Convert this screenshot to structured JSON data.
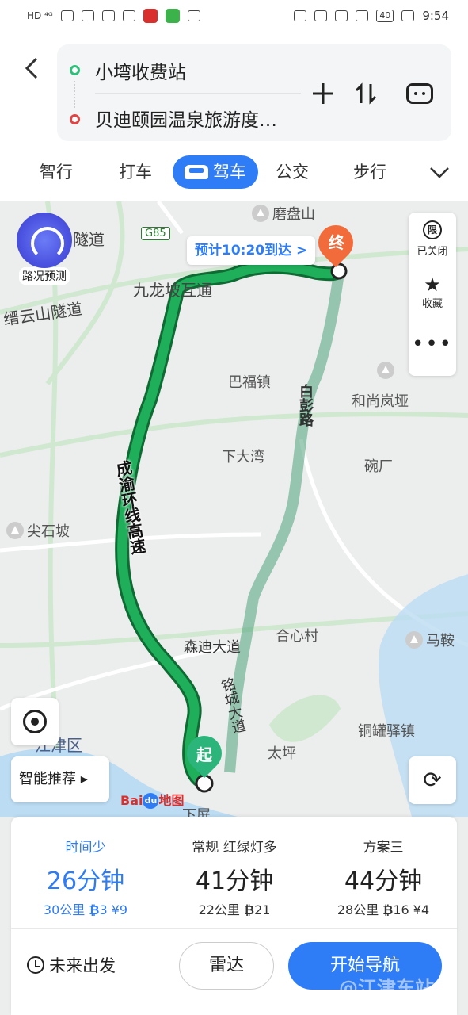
{
  "status_bar": {
    "left_text": "HD ⁴ᴳ",
    "battery": "40",
    "time": "9:54"
  },
  "header": {
    "from": "小塆收费站",
    "to": "贝迪颐园温泉旅游度…",
    "modes": [
      "智行",
      "打车",
      "驾车",
      "公交",
      "步行"
    ],
    "active_mode": "驾车"
  },
  "map": {
    "speed_widget_label": "路况预测",
    "eta_tip": "预计10:20到达 >",
    "end_pin": "终",
    "start_pin": "起",
    "side_panel": {
      "restrict_icon": "限",
      "restrict_label": "已关闭",
      "favorite_label": "收藏",
      "more": "•••"
    },
    "smart_label": "智能推荐 ▸",
    "baidu_logo": "Bai",
    "baidu_du": "du",
    "baidu_map": "地图",
    "labels": {
      "suidao": "隧道",
      "g85": "G85",
      "mopan": "磨盘山",
      "jiulongpo": "九龙坡互通",
      "jinyunshan": "缙云山隧道",
      "bafu": "巴福镇",
      "heshang": "和尚岚垭",
      "baipeng": "白彭路",
      "xiadawan": "下大湾",
      "wanchang": "碗厂",
      "jianshipo": "尖石坡",
      "chengyu": "成渝环线高速",
      "hexin": "合心村",
      "maan": "马鞍",
      "sendi": "森迪大道",
      "mingcheng": "铭城大道",
      "tongguan": "铜罐驿镇",
      "taiping": "太坪",
      "jiangjin": "江津区",
      "xiapin": "下屏"
    }
  },
  "plans": [
    {
      "tag": "时间少",
      "time": "26分钟",
      "dist": "30公里",
      "lights": "3",
      "fee": "¥9"
    },
    {
      "tag": "常规  红绿灯多",
      "time": "41分钟",
      "dist": "22公里",
      "lights": "21",
      "fee": ""
    },
    {
      "tag": "方案三",
      "time": "44分钟",
      "dist": "28公里",
      "lights": "16",
      "fee": "¥4"
    }
  ],
  "actions": {
    "future": "未来出发",
    "radar": "雷达",
    "start_nav": "开始导航"
  },
  "watermark": "@江津东站",
  "colors": {
    "accent": "#2e7cf6",
    "route_primary": "#1fae5a",
    "route_alt": "#8fcfb0",
    "start": "#2bb57b",
    "end": "#f26b3a"
  }
}
